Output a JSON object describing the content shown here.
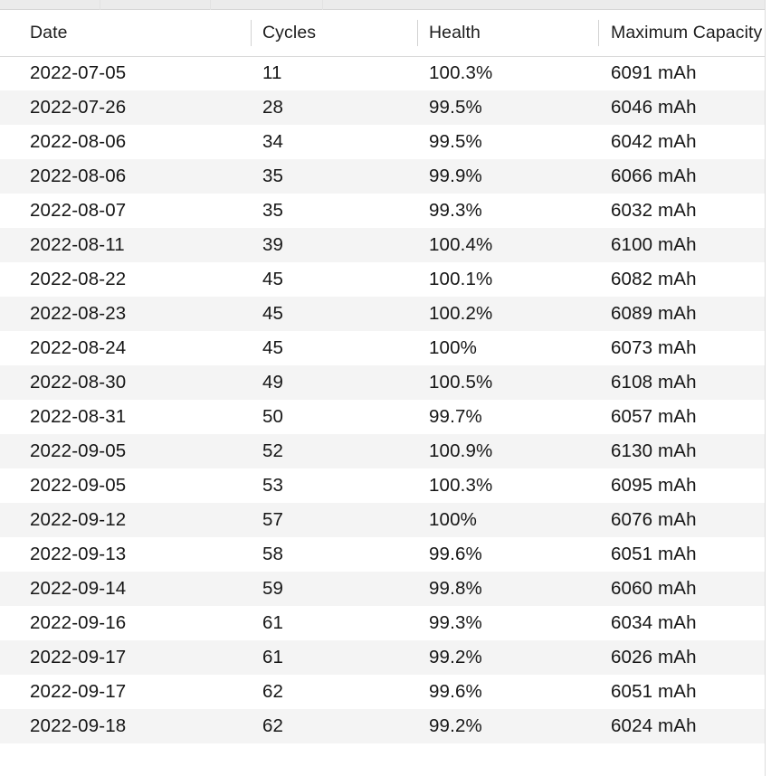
{
  "window": {
    "accent_header_bg": "#ffffff",
    "row_alt_bg": "#f4f4f4",
    "divider_color": "#d2d2d2",
    "chrome_bg": "#ebebeb"
  },
  "table": {
    "columns": [
      {
        "key": "date",
        "label": "Date"
      },
      {
        "key": "cycles",
        "label": "Cycles"
      },
      {
        "key": "health",
        "label": "Health"
      },
      {
        "key": "capacity",
        "label": "Maximum Capacity"
      }
    ],
    "column_label_visible_capacity": "Maximum Capac",
    "rows": [
      {
        "date": "2022-07-05",
        "cycles": "11",
        "health": "100.3%",
        "capacity": "6091 mAh"
      },
      {
        "date": "2022-07-26",
        "cycles": "28",
        "health": "99.5%",
        "capacity": "6046 mAh"
      },
      {
        "date": "2022-08-06",
        "cycles": "34",
        "health": "99.5%",
        "capacity": "6042 mAh"
      },
      {
        "date": "2022-08-06",
        "cycles": "35",
        "health": "99.9%",
        "capacity": "6066 mAh"
      },
      {
        "date": "2022-08-07",
        "cycles": "35",
        "health": "99.3%",
        "capacity": "6032 mAh"
      },
      {
        "date": "2022-08-11",
        "cycles": "39",
        "health": "100.4%",
        "capacity": "6100 mAh"
      },
      {
        "date": "2022-08-22",
        "cycles": "45",
        "health": "100.1%",
        "capacity": "6082 mAh"
      },
      {
        "date": "2022-08-23",
        "cycles": "45",
        "health": "100.2%",
        "capacity": "6089 mAh"
      },
      {
        "date": "2022-08-24",
        "cycles": "45",
        "health": "100%",
        "capacity": "6073 mAh"
      },
      {
        "date": "2022-08-30",
        "cycles": "49",
        "health": "100.5%",
        "capacity": "6108 mAh"
      },
      {
        "date": "2022-08-31",
        "cycles": "50",
        "health": "99.7%",
        "capacity": "6057 mAh"
      },
      {
        "date": "2022-09-05",
        "cycles": "52",
        "health": "100.9%",
        "capacity": "6130 mAh"
      },
      {
        "date": "2022-09-05",
        "cycles": "53",
        "health": "100.3%",
        "capacity": "6095 mAh"
      },
      {
        "date": "2022-09-12",
        "cycles": "57",
        "health": "100%",
        "capacity": "6076 mAh"
      },
      {
        "date": "2022-09-13",
        "cycles": "58",
        "health": "99.6%",
        "capacity": "6051 mAh"
      },
      {
        "date": "2022-09-14",
        "cycles": "59",
        "health": "99.8%",
        "capacity": "6060 mAh"
      },
      {
        "date": "2022-09-16",
        "cycles": "61",
        "health": "99.3%",
        "capacity": "6034 mAh"
      },
      {
        "date": "2022-09-17",
        "cycles": "61",
        "health": "99.2%",
        "capacity": "6026 mAh"
      },
      {
        "date": "2022-09-17",
        "cycles": "62",
        "health": "99.6%",
        "capacity": "6051 mAh"
      },
      {
        "date": "2022-09-18",
        "cycles": "62",
        "health": "99.2%",
        "capacity": "6024 mAh"
      }
    ]
  }
}
